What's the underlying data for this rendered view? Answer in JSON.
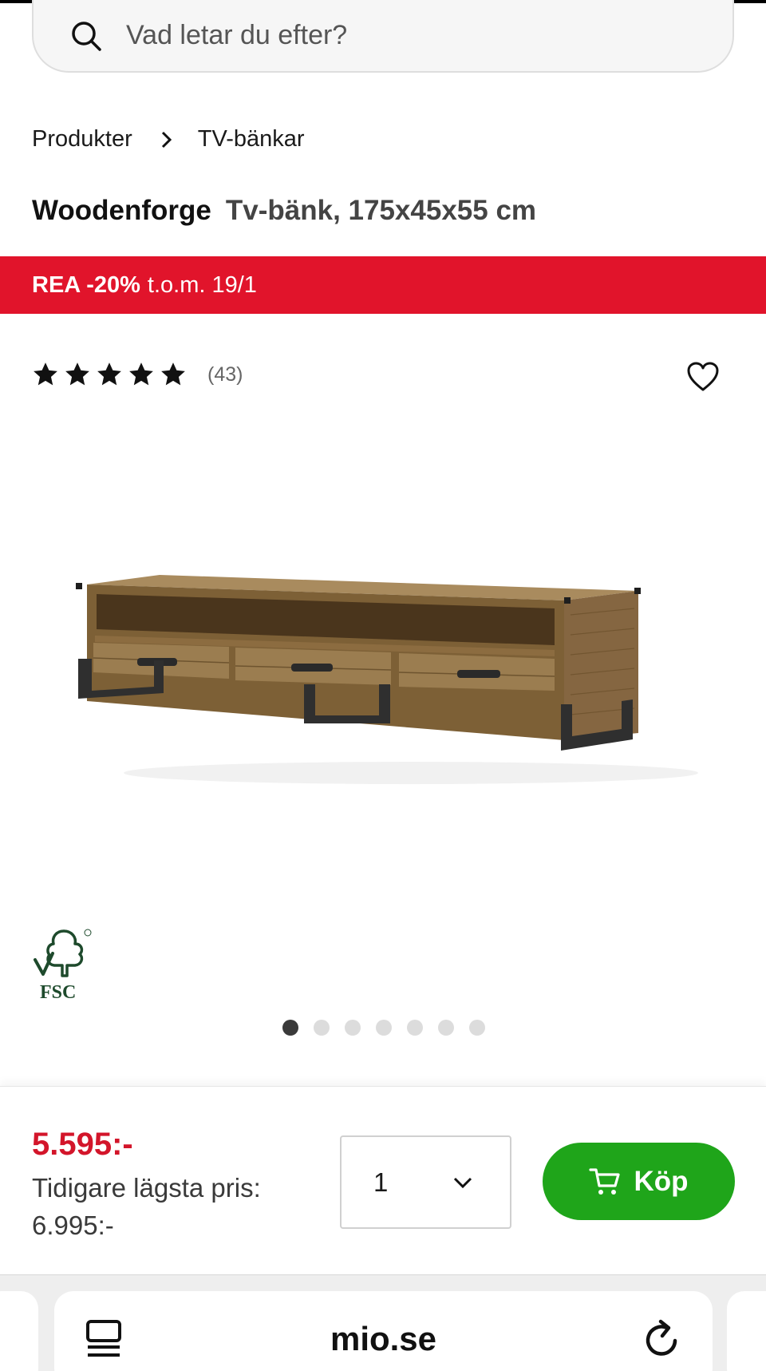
{
  "search": {
    "placeholder": "Vad letar du efter?"
  },
  "breadcrumb": {
    "items": [
      "Produkter",
      "TV-bänkar"
    ]
  },
  "product": {
    "brand": "Woodenforge",
    "description": "Tv-bänk, 175x45x55 cm",
    "rating_stars": 5,
    "review_count": "(43)",
    "image_alt": "Tv-bänk i trä med tre lådor och svarta metallben",
    "certification": "FSC"
  },
  "promo": {
    "strong": "REA -20%",
    "rest": "t.o.m. 19/1",
    "color": "#e1142b"
  },
  "gallery": {
    "total": 7,
    "active": 1
  },
  "purchase": {
    "price": "5.595:-",
    "previous_label": "Tidigare lägsta pris:",
    "previous_price": "6.995:-",
    "quantity": "1",
    "buy_label": "Köp",
    "price_color": "#d3152a",
    "buy_color": "#1fa51a"
  },
  "browser": {
    "domain": "mio.se"
  },
  "icons": [
    "search-icon",
    "chevron-right-icon",
    "star-icon",
    "heart-icon",
    "fsc-logo",
    "chevron-down-icon",
    "cart-icon",
    "menu-icon",
    "reload-icon"
  ]
}
